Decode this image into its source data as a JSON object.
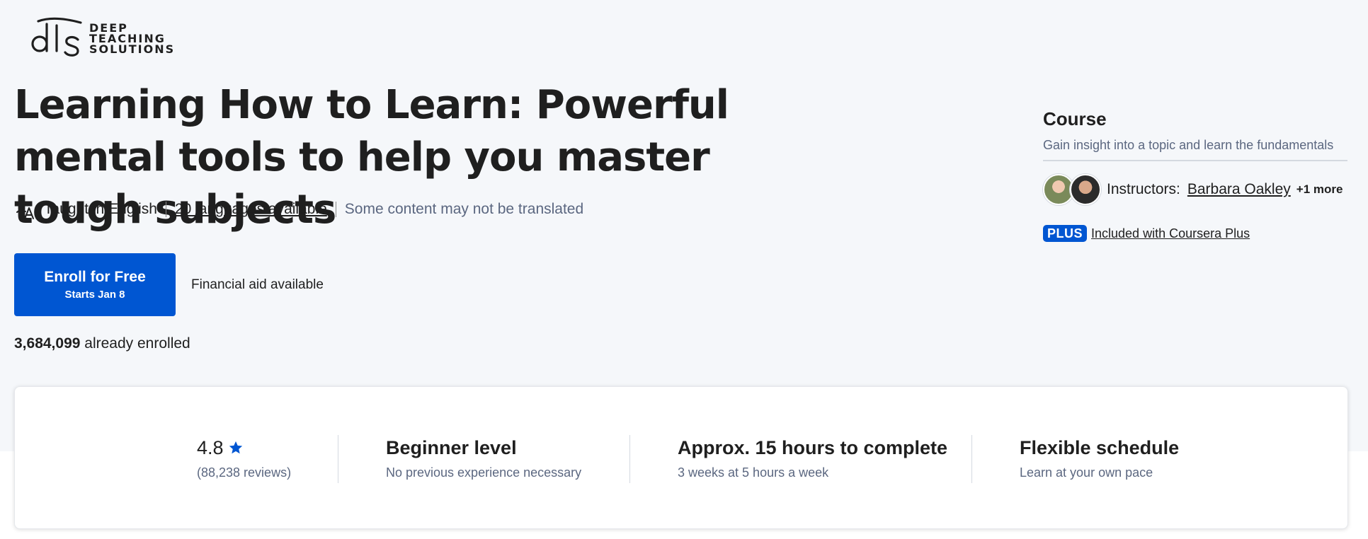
{
  "partner": {
    "logo_lines": [
      "DEEP",
      "TEACHING",
      "SOLUTIONS"
    ]
  },
  "course": {
    "title": "Learning How to Learn: Powerful mental tools to help you master tough subjects",
    "taught_in": "Taught in English",
    "languages_link": "20 languages available",
    "translation_note": "Some content may not be translated",
    "enroll_label": "Enroll for Free",
    "enroll_sub": "Starts Jan 8",
    "financial_aid": "Financial aid available",
    "enrolled_count": "3,684,099",
    "enrolled_suffix": "already enrolled"
  },
  "sidebar": {
    "type_label": "Course",
    "type_desc": "Gain insight into a topic and learn the fundamentals",
    "instructors_label": "Instructors:",
    "instructor_name": "Barbara Oakley",
    "instructor_more": "+1 more",
    "plus_badge": "PLUS",
    "plus_link": "Included with Coursera Plus"
  },
  "stats": {
    "rating": "4.8",
    "reviews": "(88,238 reviews)",
    "level": "Beginner level",
    "level_desc": "No previous experience necessary",
    "duration": "Approx. 15 hours to complete",
    "duration_desc": "3 weeks at 5 hours a week",
    "schedule": "Flexible schedule",
    "schedule_desc": "Learn at your own pace"
  },
  "colors": {
    "accent": "#0056d2",
    "hero_bg": "#f5f7fa",
    "muted_text": "#5b6780"
  },
  "icons": [
    "translate-icon",
    "star-icon"
  ]
}
